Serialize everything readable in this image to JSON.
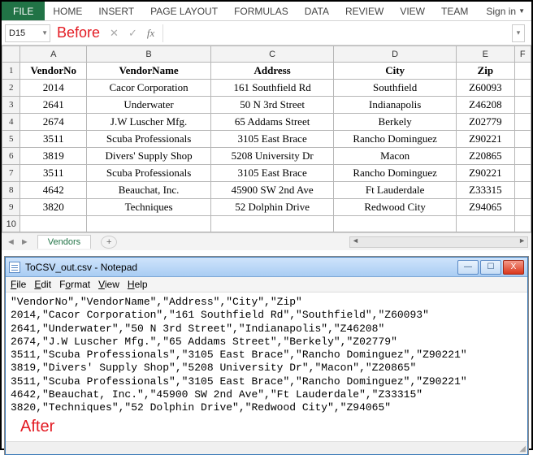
{
  "ribbon": {
    "file": "FILE",
    "tabs": [
      "HOME",
      "INSERT",
      "PAGE LAYOUT",
      "FORMULAS",
      "DATA",
      "REVIEW",
      "VIEW",
      "TEAM"
    ],
    "signin": "Sign in"
  },
  "formula_bar": {
    "cell_ref": "D15",
    "before_label": "Before",
    "fx_label": "fx"
  },
  "grid": {
    "col_letters": [
      "A",
      "B",
      "C",
      "D",
      "E",
      "F"
    ],
    "row_numbers": [
      "1",
      "2",
      "3",
      "4",
      "5",
      "6",
      "7",
      "8",
      "9",
      "10"
    ],
    "headers": [
      "VendorNo",
      "VendorName",
      "Address",
      "City",
      "Zip"
    ],
    "rows": [
      [
        "2014",
        "Cacor Corporation",
        "161 Southfield Rd",
        "Southfield",
        "Z60093"
      ],
      [
        "2641",
        "Underwater",
        "50 N 3rd Street",
        "Indianapolis",
        "Z46208"
      ],
      [
        "2674",
        "J.W Luscher Mfg.",
        "65 Addams Street",
        "Berkely",
        "Z02779"
      ],
      [
        "3511",
        "Scuba Professionals",
        "3105 East Brace",
        "Rancho Dominguez",
        "Z90221"
      ],
      [
        "3819",
        "Divers' Supply Shop",
        "5208 University Dr",
        "Macon",
        "Z20865"
      ],
      [
        "3511",
        "Scuba Professionals",
        "3105 East Brace",
        "Rancho Dominguez",
        "Z90221"
      ],
      [
        "4642",
        "Beauchat, Inc.",
        "45900 SW 2nd Ave",
        "Ft Lauderdale",
        "Z33315"
      ],
      [
        "3820",
        "Techniques",
        "52 Dolphin Drive",
        "Redwood City",
        "Z94065"
      ]
    ]
  },
  "sheet_tab": {
    "name": "Vendors",
    "add": "+"
  },
  "notepad": {
    "title": "ToCSV_out.csv - Notepad",
    "menu": {
      "file": "File",
      "edit": "Edit",
      "format": "Format",
      "view": "View",
      "help": "Help"
    },
    "content": "\"VendorNo\",\"VendorName\",\"Address\",\"City\",\"Zip\"\n2014,\"Cacor Corporation\",\"161 Southfield Rd\",\"Southfield\",\"Z60093\"\n2641,\"Underwater\",\"50 N 3rd Street\",\"Indianapolis\",\"Z46208\"\n2674,\"J.W Luscher Mfg.\",\"65 Addams Street\",\"Berkely\",\"Z02779\"\n3511,\"Scuba Professionals\",\"3105 East Brace\",\"Rancho Dominguez\",\"Z90221\"\n3819,\"Divers' Supply Shop\",\"5208 University Dr\",\"Macon\",\"Z20865\"\n3511,\"Scuba Professionals\",\"3105 East Brace\",\"Rancho Dominguez\",\"Z90221\"\n4642,\"Beauchat, Inc.\",\"45900 SW 2nd Ave\",\"Ft Lauderdale\",\"Z33315\"\n3820,\"Techniques\",\"52 Dolphin Drive\",\"Redwood City\",\"Z94065\"",
    "after_label": "After",
    "buttons": {
      "min": "—",
      "max": "☐",
      "close": "X"
    }
  }
}
